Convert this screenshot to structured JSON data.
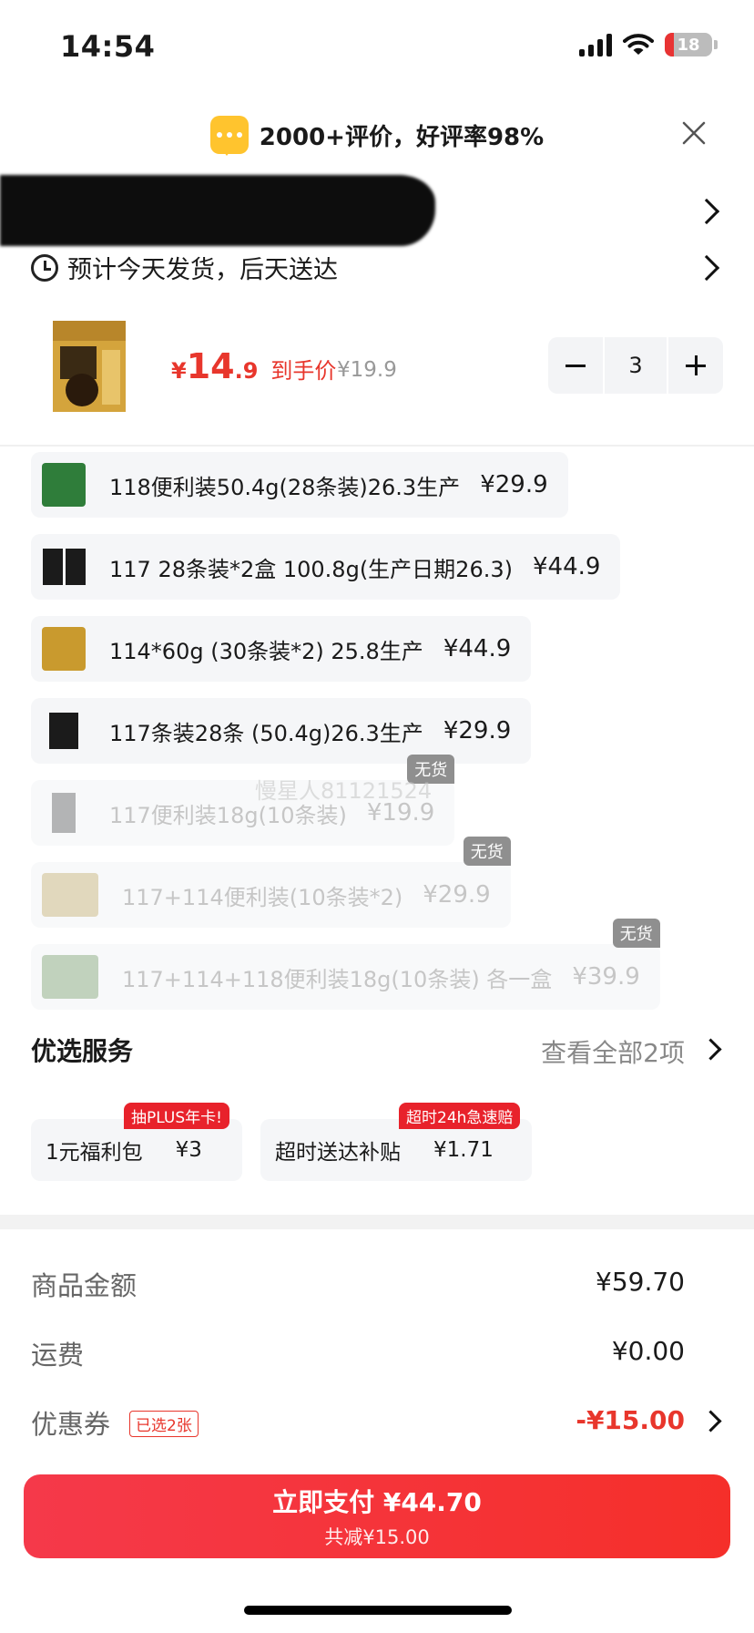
{
  "status_bar": {
    "time": "14:54",
    "battery": "18"
  },
  "review_banner": {
    "text": "2000+评价，好评率98%"
  },
  "delivery": {
    "text": "预计今天发货，后天送达"
  },
  "product": {
    "currency": "¥",
    "price_int": "14",
    "price_dec": ".9",
    "price_label": "到手价",
    "original_price": "¥19.9",
    "quantity": "3"
  },
  "variants": [
    {
      "name": "118便利装50.4g(28条装)26.3生产",
      "price": "¥29.9",
      "available": true,
      "thumb_color": "#2f7d3a"
    },
    {
      "name": "117 28条装*2盒 100.8g(生产日期26.3)",
      "price": "¥44.9",
      "available": true,
      "thumb_color": "#1b1b1b"
    },
    {
      "name": "114*60g (30条装*2) 25.8生产",
      "price": "¥44.9",
      "available": true,
      "thumb_color": "#c99a2e"
    },
    {
      "name": "117条装28条 (50.4g)26.3生产",
      "price": "¥29.9",
      "available": true,
      "thumb_color": "#1b1b1b"
    },
    {
      "name": "117便利装18g(10条装)",
      "price": "¥19.9",
      "available": false,
      "tag": "无货",
      "thumb_color": "#333333"
    },
    {
      "name": "117+114便利装(10条装*2)",
      "price": "¥29.9",
      "available": false,
      "tag": "无货",
      "thumb_color": "#b89a4a"
    },
    {
      "name": "117+114+118便利装18g(10条装) 各一盒",
      "price": "¥39.9",
      "available": false,
      "tag": "无货",
      "thumb_color": "#5c8a4a"
    }
  ],
  "watermark": "慢星人81121524",
  "services": {
    "title": "优选服务",
    "view_all": "查看全部2项",
    "items": [
      {
        "name": "1元福利包",
        "price": "¥3",
        "tag": "抽PLUS年卡!"
      },
      {
        "name": "超时送达补贴",
        "price": "¥1.71",
        "tag": "超时24h急速赔"
      }
    ]
  },
  "summary": {
    "goods_label": "商品金额",
    "goods_value": "¥59.70",
    "shipping_label": "运费",
    "shipping_value": "¥0.00",
    "coupon_label": "优惠券",
    "coupon_tag": "已选2张",
    "coupon_value": "-¥15.00"
  },
  "pay": {
    "label": "立即支付 ¥44.70",
    "sub": "共减¥15.00"
  },
  "colors": {
    "accent": "#e8362c",
    "tag_red": "#e8222b",
    "button_red": "#f5394a"
  }
}
